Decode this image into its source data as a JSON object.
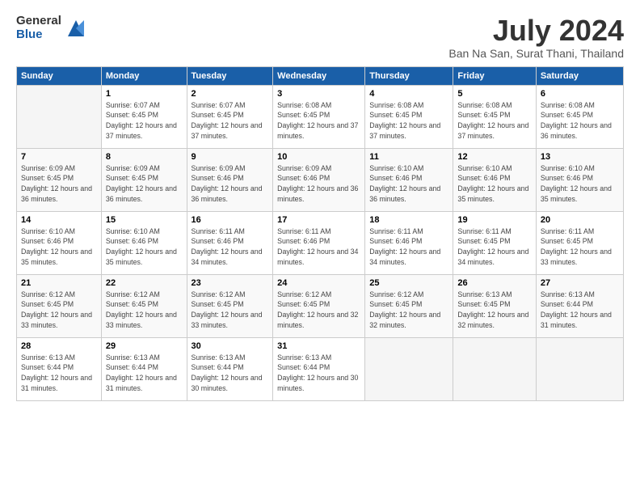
{
  "header": {
    "logo_general": "General",
    "logo_blue": "Blue",
    "month_title": "July 2024",
    "location": "Ban Na San, Surat Thani, Thailand"
  },
  "days_of_week": [
    "Sunday",
    "Monday",
    "Tuesday",
    "Wednesday",
    "Thursday",
    "Friday",
    "Saturday"
  ],
  "weeks": [
    [
      {
        "day": "",
        "empty": true
      },
      {
        "day": "1",
        "sunrise": "6:07 AM",
        "sunset": "6:45 PM",
        "daylight": "12 hours and 37 minutes."
      },
      {
        "day": "2",
        "sunrise": "6:07 AM",
        "sunset": "6:45 PM",
        "daylight": "12 hours and 37 minutes."
      },
      {
        "day": "3",
        "sunrise": "6:08 AM",
        "sunset": "6:45 PM",
        "daylight": "12 hours and 37 minutes."
      },
      {
        "day": "4",
        "sunrise": "6:08 AM",
        "sunset": "6:45 PM",
        "daylight": "12 hours and 37 minutes."
      },
      {
        "day": "5",
        "sunrise": "6:08 AM",
        "sunset": "6:45 PM",
        "daylight": "12 hours and 37 minutes."
      },
      {
        "day": "6",
        "sunrise": "6:08 AM",
        "sunset": "6:45 PM",
        "daylight": "12 hours and 36 minutes."
      }
    ],
    [
      {
        "day": "7",
        "sunrise": "6:09 AM",
        "sunset": "6:45 PM",
        "daylight": "12 hours and 36 minutes."
      },
      {
        "day": "8",
        "sunrise": "6:09 AM",
        "sunset": "6:45 PM",
        "daylight": "12 hours and 36 minutes."
      },
      {
        "day": "9",
        "sunrise": "6:09 AM",
        "sunset": "6:46 PM",
        "daylight": "12 hours and 36 minutes."
      },
      {
        "day": "10",
        "sunrise": "6:09 AM",
        "sunset": "6:46 PM",
        "daylight": "12 hours and 36 minutes."
      },
      {
        "day": "11",
        "sunrise": "6:10 AM",
        "sunset": "6:46 PM",
        "daylight": "12 hours and 36 minutes."
      },
      {
        "day": "12",
        "sunrise": "6:10 AM",
        "sunset": "6:46 PM",
        "daylight": "12 hours and 35 minutes."
      },
      {
        "day": "13",
        "sunrise": "6:10 AM",
        "sunset": "6:46 PM",
        "daylight": "12 hours and 35 minutes."
      }
    ],
    [
      {
        "day": "14",
        "sunrise": "6:10 AM",
        "sunset": "6:46 PM",
        "daylight": "12 hours and 35 minutes."
      },
      {
        "day": "15",
        "sunrise": "6:10 AM",
        "sunset": "6:46 PM",
        "daylight": "12 hours and 35 minutes."
      },
      {
        "day": "16",
        "sunrise": "6:11 AM",
        "sunset": "6:46 PM",
        "daylight": "12 hours and 34 minutes."
      },
      {
        "day": "17",
        "sunrise": "6:11 AM",
        "sunset": "6:46 PM",
        "daylight": "12 hours and 34 minutes."
      },
      {
        "day": "18",
        "sunrise": "6:11 AM",
        "sunset": "6:46 PM",
        "daylight": "12 hours and 34 minutes."
      },
      {
        "day": "19",
        "sunrise": "6:11 AM",
        "sunset": "6:45 PM",
        "daylight": "12 hours and 34 minutes."
      },
      {
        "day": "20",
        "sunrise": "6:11 AM",
        "sunset": "6:45 PM",
        "daylight": "12 hours and 33 minutes."
      }
    ],
    [
      {
        "day": "21",
        "sunrise": "6:12 AM",
        "sunset": "6:45 PM",
        "daylight": "12 hours and 33 minutes."
      },
      {
        "day": "22",
        "sunrise": "6:12 AM",
        "sunset": "6:45 PM",
        "daylight": "12 hours and 33 minutes."
      },
      {
        "day": "23",
        "sunrise": "6:12 AM",
        "sunset": "6:45 PM",
        "daylight": "12 hours and 33 minutes."
      },
      {
        "day": "24",
        "sunrise": "6:12 AM",
        "sunset": "6:45 PM",
        "daylight": "12 hours and 32 minutes."
      },
      {
        "day": "25",
        "sunrise": "6:12 AM",
        "sunset": "6:45 PM",
        "daylight": "12 hours and 32 minutes."
      },
      {
        "day": "26",
        "sunrise": "6:13 AM",
        "sunset": "6:45 PM",
        "daylight": "12 hours and 32 minutes."
      },
      {
        "day": "27",
        "sunrise": "6:13 AM",
        "sunset": "6:44 PM",
        "daylight": "12 hours and 31 minutes."
      }
    ],
    [
      {
        "day": "28",
        "sunrise": "6:13 AM",
        "sunset": "6:44 PM",
        "daylight": "12 hours and 31 minutes."
      },
      {
        "day": "29",
        "sunrise": "6:13 AM",
        "sunset": "6:44 PM",
        "daylight": "12 hours and 31 minutes."
      },
      {
        "day": "30",
        "sunrise": "6:13 AM",
        "sunset": "6:44 PM",
        "daylight": "12 hours and 30 minutes."
      },
      {
        "day": "31",
        "sunrise": "6:13 AM",
        "sunset": "6:44 PM",
        "daylight": "12 hours and 30 minutes."
      },
      {
        "day": "",
        "empty": true
      },
      {
        "day": "",
        "empty": true
      },
      {
        "day": "",
        "empty": true
      }
    ]
  ]
}
